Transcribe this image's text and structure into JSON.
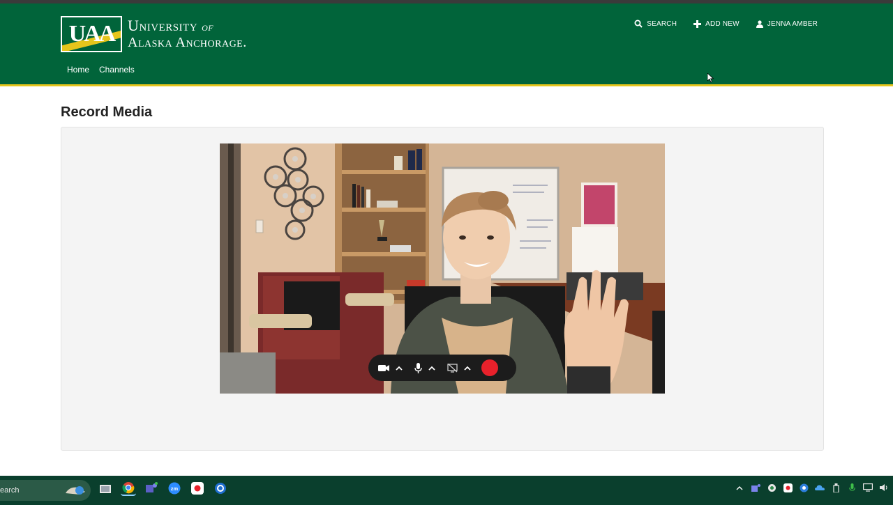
{
  "app": {
    "logo_mark": "UAA",
    "logo_line1": "University",
    "logo_of": "of",
    "logo_line2": "Alaska Anchorage.",
    "colors": {
      "brand_green": "#01643a",
      "accent_gold": "#e6c51c",
      "record_red": "#e8212b"
    }
  },
  "header": {
    "search_label": "SEARCH",
    "add_new_label": "ADD NEW",
    "user_label": "JENNA AMBER",
    "icons": [
      "search-icon",
      "plus-icon",
      "user-icon"
    ]
  },
  "nav": {
    "home": "Home",
    "channels": "Channels"
  },
  "main": {
    "title": "Record Media"
  },
  "recorder": {
    "controls": [
      "camera-icon",
      "chevron-up-icon",
      "microphone-icon",
      "chevron-up-icon",
      "screen-share-off-icon",
      "chevron-up-icon",
      "record-button"
    ]
  },
  "taskbar": {
    "search_text": "earch",
    "apps": [
      "file-explorer-icon",
      "chrome-icon",
      "teams-icon",
      "zoom-icon",
      "record-app-icon",
      "browser-icon"
    ],
    "tray": [
      "chevron-up-icon",
      "teams-tray-icon",
      "network-icon",
      "app-tray-icon",
      "app-tray-icon",
      "onedrive-icon",
      "usb-icon",
      "mic-icon",
      "display-icon",
      "volume-icon"
    ]
  }
}
